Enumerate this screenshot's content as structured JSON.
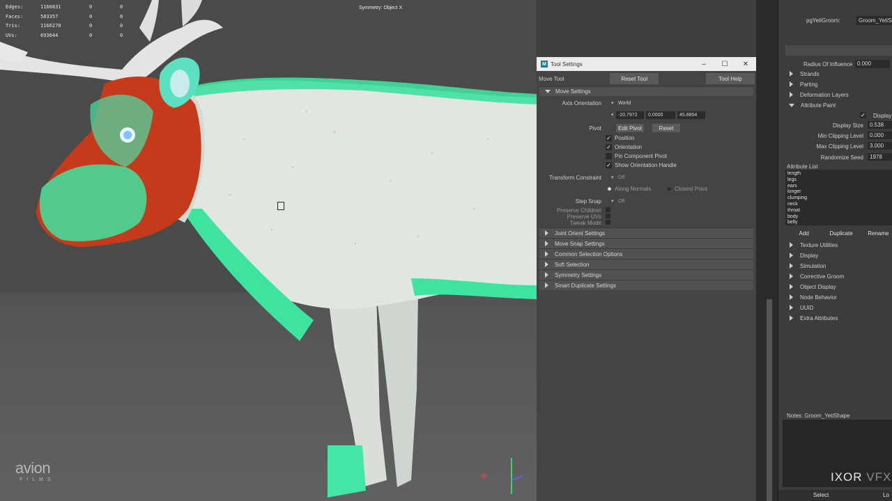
{
  "hud": {
    "rows": [
      {
        "label": "Edges:",
        "value": "1166831",
        "a": "0",
        "b": "0"
      },
      {
        "label": "Faces:",
        "value": "583357",
        "a": "0",
        "b": "0"
      },
      {
        "label": "Tris:",
        "value": "1166270",
        "a": "0",
        "b": "0"
      },
      {
        "label": "UVs:",
        "value": "693644",
        "a": "0",
        "b": "0"
      }
    ],
    "symmetry": "Symmetry: Object X"
  },
  "logo": {
    "main": "avion",
    "sub": "FILMS"
  },
  "tool_settings": {
    "window_title": "Tool Settings",
    "window_buttons": [
      "–",
      "☐",
      "✕"
    ],
    "tool_name": "Move Tool",
    "reset_tool": "Reset Tool",
    "tool_help": "Tool Help",
    "move_settings": "Move Settings",
    "axis_orientation_label": "Axis Orientation",
    "axis_orientation_value": "World",
    "coords": [
      "-20.7972",
      "0.0000",
      "45.8854"
    ],
    "pivot_label": "Pivot",
    "edit_pivot": "Edit Pivot",
    "reset": "Reset",
    "checks": [
      {
        "label": "Position",
        "checked": true
      },
      {
        "label": "Orientation",
        "checked": true
      },
      {
        "label": "Pin Component Pivot",
        "checked": false
      },
      {
        "label": "Show Orientation Handle",
        "checked": true
      }
    ],
    "transform_constraint_label": "Transform Constraint",
    "transform_constraint_value": "Off",
    "along_normals": "Along Normals",
    "closest_point": "Closest Point",
    "step_snap_label": "Step Snap",
    "step_snap_value": "Off",
    "preserve_children": "Preserve Children",
    "preserve_uvs": "Preserve UVs",
    "tweak_mode": "Tweak Mode",
    "frames": [
      "Joint Orient Settings",
      "Move Snap Settings",
      "Common Selection Options",
      "Soft Selection",
      "Symmetry Settings",
      "Smart Duplicate Settings"
    ]
  },
  "attr_editor": {
    "node_label": "pgYetiGroom:",
    "node_value": "Groom_YetiSha",
    "radius_label": "Radius Of Influence",
    "radius_value": "0.000",
    "frames_top": [
      "Strands",
      "Parting",
      "Deformation Layers"
    ],
    "attr_paint": "Attribute Paint",
    "display_check": "Display",
    "paint_rows": [
      {
        "label": "Display Size",
        "value": "0.538"
      },
      {
        "label": "Min Clipping Level",
        "value": "0.000"
      },
      {
        "label": "Max Clipping Level",
        "value": "3.000"
      },
      {
        "label": "Randomize Seed",
        "value": "1978"
      }
    ],
    "attribute_list_label": "Attribute List",
    "attribute_list": [
      "length",
      "legs",
      "ears",
      "longer",
      "clumping",
      "neck",
      "throat",
      "body",
      "belly"
    ],
    "buttons": [
      "Add",
      "Duplicate",
      "Rename"
    ],
    "frames_bottom": [
      "Texture Utilities",
      "Display",
      "Simulation",
      "Corrective Groom",
      "Object Display",
      "Node Behavior",
      "UUID",
      "Extra Attributes"
    ],
    "notes": "Notes: Groom_YetiShape",
    "watermark_main": "IXOR",
    "watermark_vfx": "VFX",
    "bottom_select": "Select",
    "bottom_load": "Lo"
  }
}
